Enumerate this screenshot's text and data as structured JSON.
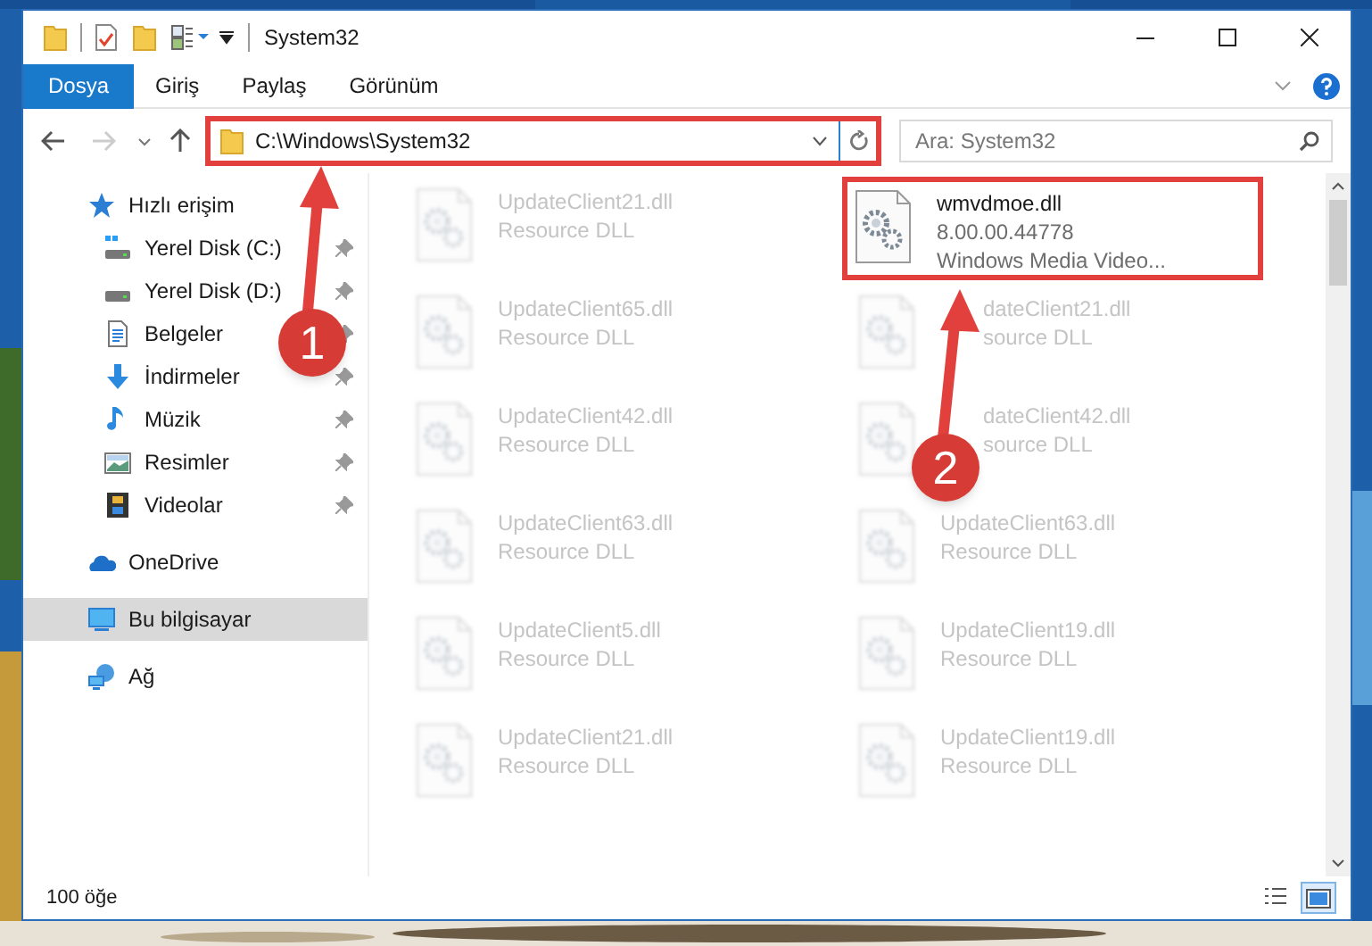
{
  "window": {
    "title": "System32"
  },
  "ribbon_tabs": [
    {
      "label": "Dosya",
      "kind": "file"
    },
    {
      "label": "Giriş",
      "kind": "tab"
    },
    {
      "label": "Paylaş",
      "kind": "tab"
    },
    {
      "label": "Görünüm",
      "kind": "tab"
    }
  ],
  "address_bar": {
    "path": "C:\\Windows\\System32",
    "highlighted": true
  },
  "search": {
    "placeholder": "Ara: System32"
  },
  "sidebar": {
    "items": [
      {
        "label": "Hızlı erişim",
        "kind": "star",
        "selected": false,
        "children": [
          {
            "label": "Yerel Disk (C:)",
            "kind": "drive-c",
            "pinned": true,
            "selected": false
          },
          {
            "label": "Yerel Disk (D:)",
            "kind": "drive",
            "pinned": true,
            "selected": false
          },
          {
            "label": "Belgeler",
            "kind": "document",
            "pinned": true,
            "selected": false
          },
          {
            "label": "İndirmeler",
            "kind": "download",
            "pinned": true,
            "selected": false
          },
          {
            "label": "Müzik",
            "kind": "music",
            "pinned": true,
            "selected": false
          },
          {
            "label": "Resimler",
            "pinned": true,
            "selected": false
          },
          {
            "label": "Videolar",
            "kind": "video",
            "pinned": true,
            "selected": false
          }
        ]
      },
      {
        "label": "OneDrive",
        "kind": "cloud",
        "selected": false
      },
      {
        "label": "Bu bilgisayar",
        "kind": "computer",
        "selected": true
      },
      {
        "label": "Ağ",
        "kind": "network",
        "selected": false
      }
    ]
  },
  "files": [
    {
      "lines": [
        "UpdateClient21.dll",
        "Resource DLL"
      ],
      "blurred": true,
      "highlighted": false
    },
    {
      "lines": [
        "wmvdmoe.dll",
        "8.00.00.44778",
        "Windows Media Video..."
      ],
      "blurred": false,
      "highlighted": true
    },
    {
      "lines": [
        "UpdateClient65.dll",
        "Resource DLL"
      ],
      "blurred": true,
      "highlighted": false
    },
    {
      "lines": [
        "dateClient21.dll",
        "source DLL"
      ],
      "blurred": true,
      "highlighted": false,
      "partly_covered": true
    },
    {
      "lines": [
        "UpdateClient42.dll",
        "Resource DLL"
      ],
      "blurred": true,
      "highlighted": false
    },
    {
      "lines": [
        "dateClient42.dll",
        "source DLL"
      ],
      "blurred": true,
      "highlighted": false,
      "partly_covered": true
    },
    {
      "lines": [
        "UpdateClient63.dll",
        "Resource DLL"
      ],
      "blurred": true,
      "highlighted": false
    },
    {
      "lines": [
        "UpdateClient63.dll",
        "Resource DLL"
      ],
      "blurred": true,
      "highlighted": false
    },
    {
      "lines": [
        "UpdateClient5.dll",
        "Resource DLL"
      ],
      "blurred": true,
      "highlighted": false
    },
    {
      "lines": [
        "UpdateClient19.dll",
        "Resource DLL"
      ],
      "blurred": true,
      "highlighted": false
    },
    {
      "lines": [
        "UpdateClient21.dll",
        "Resource DLL"
      ],
      "blurred": true,
      "highlighted": false
    },
    {
      "lines": [
        "UpdateClient19.dll",
        "Resource DLL"
      ],
      "blurred": true,
      "highlighted": false
    }
  ],
  "callouts": [
    {
      "number": "1"
    },
    {
      "number": "2"
    }
  ],
  "status_bar": {
    "count": "100 öğe",
    "views": [
      {
        "kind": "details",
        "selected": false
      },
      {
        "kind": "large-icons",
        "selected": true
      }
    ]
  }
}
